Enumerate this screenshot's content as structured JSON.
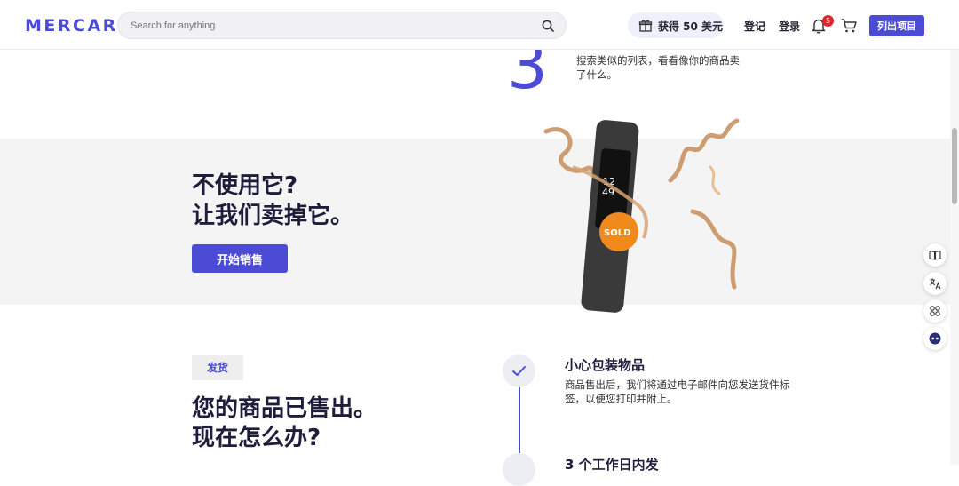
{
  "header": {
    "logo": "MERCARI",
    "search_placeholder": "Search for anything",
    "gift_label": "获得 50 美元",
    "register": "登记",
    "login": "登录",
    "notification_count": "5",
    "list_item_button": "列出项目"
  },
  "step3": {
    "number": "3",
    "text": "搜索类似的列表，看看像你的商品卖了什么。"
  },
  "banner": {
    "title_line1": "不使用它?",
    "title_line2": "让我们卖掉它。",
    "button": "开始销售",
    "watch_time_hour": "12",
    "watch_time_min": "49",
    "sold_label": "SOLD"
  },
  "shipping": {
    "tag": "发货",
    "title_line1": "您的商品已售出。",
    "title_line2": "现在怎么办?",
    "step1_title": "小心包装物品",
    "step1_text": "商品售出后，我们将通过电子邮件向您发送货件标签，以便您打印并附上。",
    "step2_title": "3 个工作日内发"
  },
  "colors": {
    "accent": "#4b4bd6",
    "banner_bg": "#f4f4f4",
    "badge_red": "#e0262d",
    "sold_orange": "#f08a1c"
  },
  "icons": [
    "search-icon",
    "gift-icon",
    "bell-icon",
    "cart-icon",
    "check-icon",
    "book-icon",
    "translate-icon",
    "apps-icon",
    "assistant-icon"
  ]
}
